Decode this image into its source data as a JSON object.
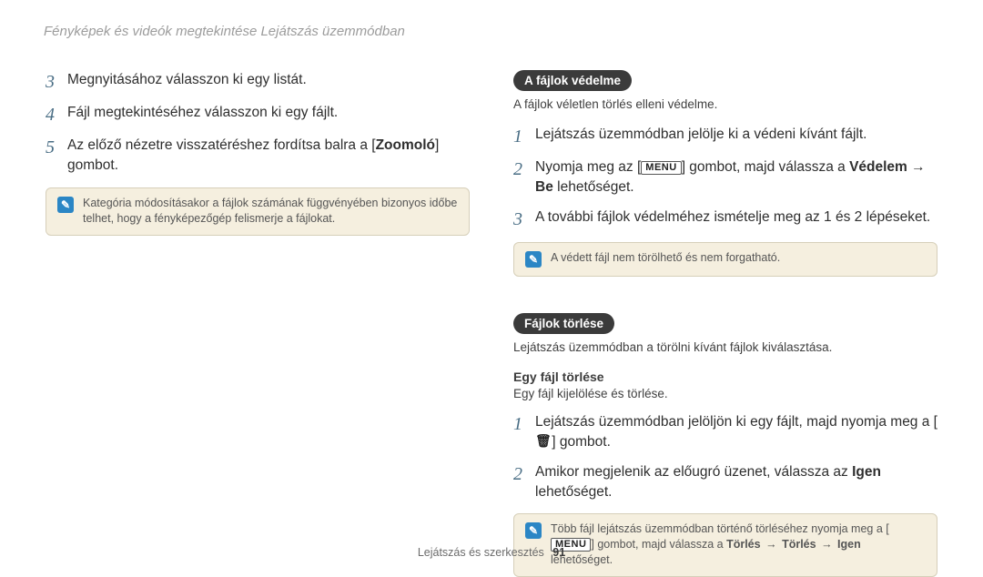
{
  "running_head": "Fényképek és videók megtekintése Lejátszás üzemmódban",
  "left": {
    "steps": {
      "s3": "Megnyitásához válasszon ki egy listát.",
      "s4": "Fájl megtekintéséhez válasszon ki egy fájlt.",
      "s5_a": "Az előző nézetre visszatéréshez fordítsa balra a [",
      "s5_bold": "Zoomoló",
      "s5_b": "] gombot."
    },
    "note": "Kategória módosításakor a fájlok számának függvényében bizonyos időbe telhet, hogy a fényképezőgép felismerje a fájlokat."
  },
  "right": {
    "protect": {
      "pill": "A fájlok védelme",
      "sub": "A fájlok véletlen törlés elleni védelme.",
      "s1": "Lejátszás üzemmódban jelölje ki a védeni kívánt fájlt.",
      "s2_a": "Nyomja meg az [",
      "s2_menu": "MENU",
      "s2_b": "] gombot, majd válassza a ",
      "s2_bold1": "Védelem",
      "s2_arrow": "→",
      "s2_bold2": "Be",
      "s2_c": " lehetőséget.",
      "s3": "A további fájlok védelméhez ismételje meg az 1 és 2 lépéseket.",
      "note": "A védett fájl nem törölhető és nem forgatható."
    },
    "delete": {
      "pill": "Fájlok törlése",
      "sub": "Lejátszás üzemmódban a törölni kívánt fájlok kiválasztása.",
      "subhead": "Egy fájl törlése",
      "subhead_sub": "Egy fájl kijelölése és törlése.",
      "s1_a": "Lejátszás üzemmódban jelöljön ki egy fájlt, majd nyomja meg a [",
      "s1_trash": "🗑",
      "s1_b": "] gombot.",
      "s2_a": "Amikor megjelenik az előugró üzenet, válassza az ",
      "s2_bold": "Igen",
      "s2_b": " lehetőséget.",
      "note_a": "Több fájl lejátszás üzemmódban történő törléséhez nyomja meg a [",
      "note_menu": "MENU",
      "note_b": "] gombot, majd válassza a ",
      "note_bold1": "Törlés",
      "note_arrow": "→",
      "note_bold2": "Törlés",
      "note_bold3": "Igen",
      "note_c": " lehetőséget."
    }
  },
  "footer": {
    "section": "Lejátszás és szerkesztés",
    "page": "91"
  }
}
